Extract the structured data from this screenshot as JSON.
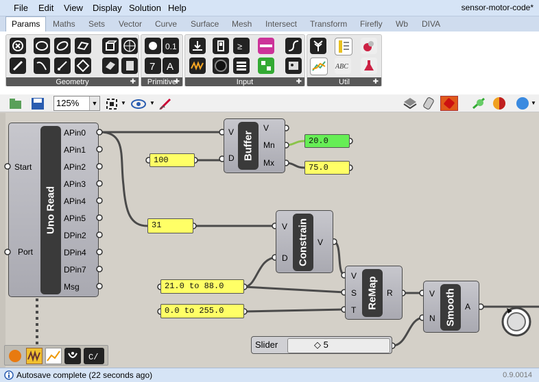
{
  "menu": {
    "items": [
      "File",
      "Edit",
      "View",
      "Display",
      "Solution",
      "Help"
    ],
    "document_title": "sensor-motor-code*"
  },
  "tabs": [
    "Params",
    "Maths",
    "Sets",
    "Vector",
    "Curve",
    "Surface",
    "Mesh",
    "Intersect",
    "Transform",
    "Firefly",
    "Wb",
    "DIVA"
  ],
  "ribbon": {
    "groups": [
      {
        "label": "Geometry"
      },
      {
        "label": "Primitive"
      },
      {
        "label": "Input"
      },
      {
        "label": "Util"
      }
    ]
  },
  "toolbar": {
    "zoom": "125%"
  },
  "components": {
    "uno_read": {
      "name": "Uno Read",
      "inputs": [
        "Start",
        "Port"
      ],
      "outputs": [
        "APin0",
        "APin1",
        "APin2",
        "APin3",
        "APin4",
        "APin5",
        "DPin2",
        "DPin4",
        "DPin7",
        "Msg"
      ]
    },
    "buffer": {
      "name": "Buffer",
      "inputs": [
        "V",
        "D"
      ],
      "outputs": [
        "V",
        "Mn",
        "Mx"
      ]
    },
    "constrain": {
      "name": "Constrain",
      "inputs": [
        "V",
        "D"
      ],
      "outputs": [
        "V"
      ]
    },
    "remap": {
      "name": "ReMap",
      "inputs": [
        "V",
        "S",
        "T"
      ],
      "outputs": [
        "R"
      ]
    },
    "smooth": {
      "name": "Smooth",
      "inputs": [
        "V",
        "N"
      ],
      "outputs": [
        "A"
      ]
    }
  },
  "panels": {
    "buffer_domain": "100",
    "buffer_min": "20.0",
    "buffer_max": "75.0",
    "sensor_value": "31",
    "source_domain": "21.0 to 88.0",
    "target_domain": "0.0 to 255.0"
  },
  "slider": {
    "label": "Slider",
    "value": "5"
  },
  "status": {
    "text": "Autosave complete (22 seconds ago)",
    "version": "0.9.0014"
  },
  "colors": {
    "menu_bg": "#d6e4f6",
    "panel_yellow": "#ffff66",
    "panel_green": "#66ee55",
    "component_core": "#3a3a3a"
  }
}
